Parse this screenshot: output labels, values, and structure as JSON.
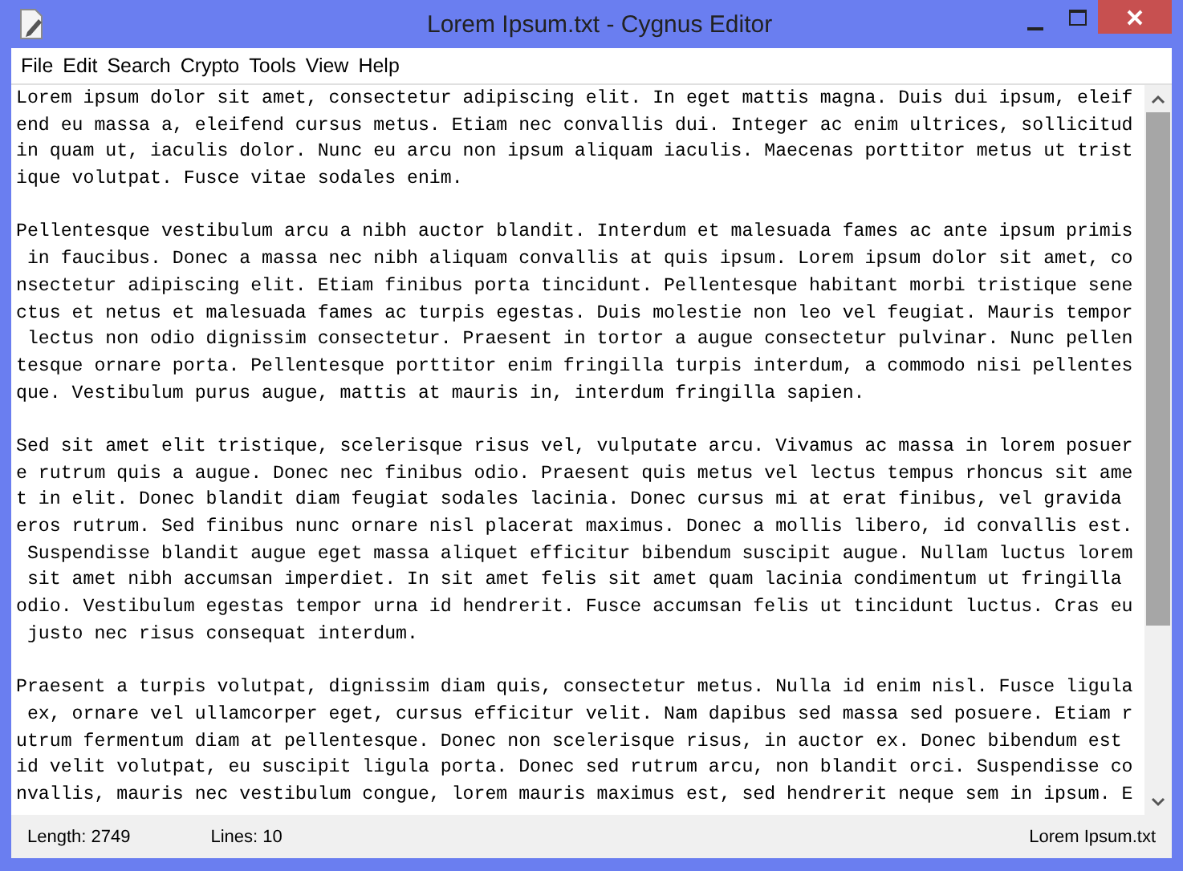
{
  "window": {
    "title": "Lorem Ipsum.txt - Cygnus Editor"
  },
  "menu": [
    "File",
    "Edit",
    "Search",
    "Crypto",
    "Tools",
    "View",
    "Help"
  ],
  "editor": {
    "paragraphs": [
      [
        "Lorem ipsum dolor sit amet, consectetur adipiscing elit. In eget mattis magna. Duis dui ipsum, eleif",
        "end eu massa a, eleifend cursus metus. Etiam nec convallis dui. Integer ac enim ultrices, sollicitud",
        "in quam ut, iaculis dolor. Nunc eu arcu non ipsum aliquam iaculis. Maecenas porttitor metus ut trist",
        "ique volutpat. Fusce vitae sodales enim."
      ],
      [
        "Pellentesque vestibulum arcu a nibh auctor blandit. Interdum et malesuada fames ac ante ipsum primis",
        " in faucibus. Donec a massa nec nibh aliquam convallis at quis ipsum. Lorem ipsum dolor sit amet, co",
        "nsectetur adipiscing elit. Etiam finibus porta tincidunt. Pellentesque habitant morbi tristique sene",
        "ctus et netus et malesuada fames ac turpis egestas. Duis molestie non leo vel feugiat. Mauris tempor",
        " lectus non odio dignissim consectetur. Praesent in tortor a augue consectetur pulvinar. Nunc pellen",
        "tesque ornare porta. Pellentesque porttitor enim fringilla turpis interdum, a commodo nisi pellentes",
        "que. Vestibulum purus augue, mattis at mauris in, interdum fringilla sapien."
      ],
      [
        "Sed sit amet elit tristique, scelerisque risus vel, vulputate arcu. Vivamus ac massa in lorem posuer",
        "e rutrum quis a augue. Donec nec finibus odio. Praesent quis metus vel lectus tempus rhoncus sit ame",
        "t in elit. Donec blandit diam feugiat sodales lacinia. Donec cursus mi at erat finibus, vel gravida ",
        "eros rutrum. Sed finibus nunc ornare nisl placerat maximus. Donec a mollis libero, id convallis est.",
        " Suspendisse blandit augue eget massa aliquet efficitur bibendum suscipit augue. Nullam luctus lorem",
        " sit amet nibh accumsan imperdiet. In sit amet felis sit amet quam lacinia condimentum ut fringilla ",
        "odio. Vestibulum egestas tempor urna id hendrerit. Fusce accumsan felis ut tincidunt luctus. Cras eu",
        " justo nec risus consequat interdum."
      ],
      [
        "Praesent a turpis volutpat, dignissim diam quis, consectetur metus. Nulla id enim nisl. Fusce ligula",
        " ex, ornare vel ullamcorper eget, cursus efficitur velit. Nam dapibus sed massa sed posuere. Etiam r",
        "utrum fermentum diam at pellentesque. Donec non scelerisque risus, in auctor ex. Donec bibendum est ",
        "id velit volutpat, eu suscipit ligula porta. Donec sed rutrum arcu, non blandit orci. Suspendisse co",
        "nvallis, mauris nec vestibulum congue, lorem mauris maximus est, sed hendrerit neque sem in ipsum. E"
      ]
    ]
  },
  "status_bar": {
    "length": "Length: 2749",
    "lines": "Lines: 10",
    "file": "Lorem Ipsum.txt"
  }
}
